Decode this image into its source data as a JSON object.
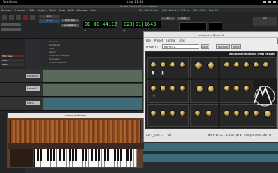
{
  "topbar": {
    "activities": "Activities",
    "clock": "mar 21:30"
  },
  "ardour": {
    "title": "Studio Projects/Demo - Ardour",
    "menu": [
      "Session",
      "Transport",
      "Edit",
      "Region",
      "Track",
      "View",
      "JACK",
      "Window",
      "Help"
    ],
    "clock_primary": "00:00:44:12",
    "clock_secondary": "023|01|1643",
    "clock_primary_sub": "NT",
    "clock_secondary_sub": "BBT",
    "punch_in": "In",
    "punch_out": "Out",
    "ruler_labels": [
      "Timecode",
      "Bars:Beats",
      "Meter",
      "Tempo",
      "Loop/Punch Ranges",
      "CD Markers",
      "Location Markers"
    ],
    "tracks": [
      {
        "name": "Basse DX"
      },
      {
        "name": "Basse LZ"
      },
      {
        "name": "Piano"
      }
    ],
    "left_rows": [
      "MIDI Bass",
      "Bass",
      "Piano"
    ],
    "status": {
      "file": "File: WAV 32-float",
      "jack": "JACK: 44.1 kHz / 23.2 ms",
      "buffers": "Buffers: p:100% c:100%",
      "dsp": "DSP: 13.1%",
      "disk": "Disk: 5h"
    },
    "transport_labels": [
      "Shuttle",
      "Mode",
      "Sync",
      "Auto Play",
      "Auto Return"
    ],
    "solo": "Solo",
    "punch": "Punch"
  },
  "synth": {
    "title": "amSynth - Devon 1",
    "menu": [
      "File",
      "Preset",
      "Config",
      "Utils"
    ],
    "preset_label": "Preset 0:",
    "preset_name": "Derren 1",
    "save_label": "Save",
    "audition_label": "Audition",
    "panic_label": "Panic",
    "banner": "Analogue Modeling SYNTHesizer",
    "logo_text": "amSYNTH",
    "status_left": "osc2_sync = 1.000",
    "status_mid": "MIDI: ALSA - Audio: JACK",
    "status_right": "Sample Rate: 44100"
  },
  "sulima": {
    "title": "sulima (Setbfaat)"
  }
}
